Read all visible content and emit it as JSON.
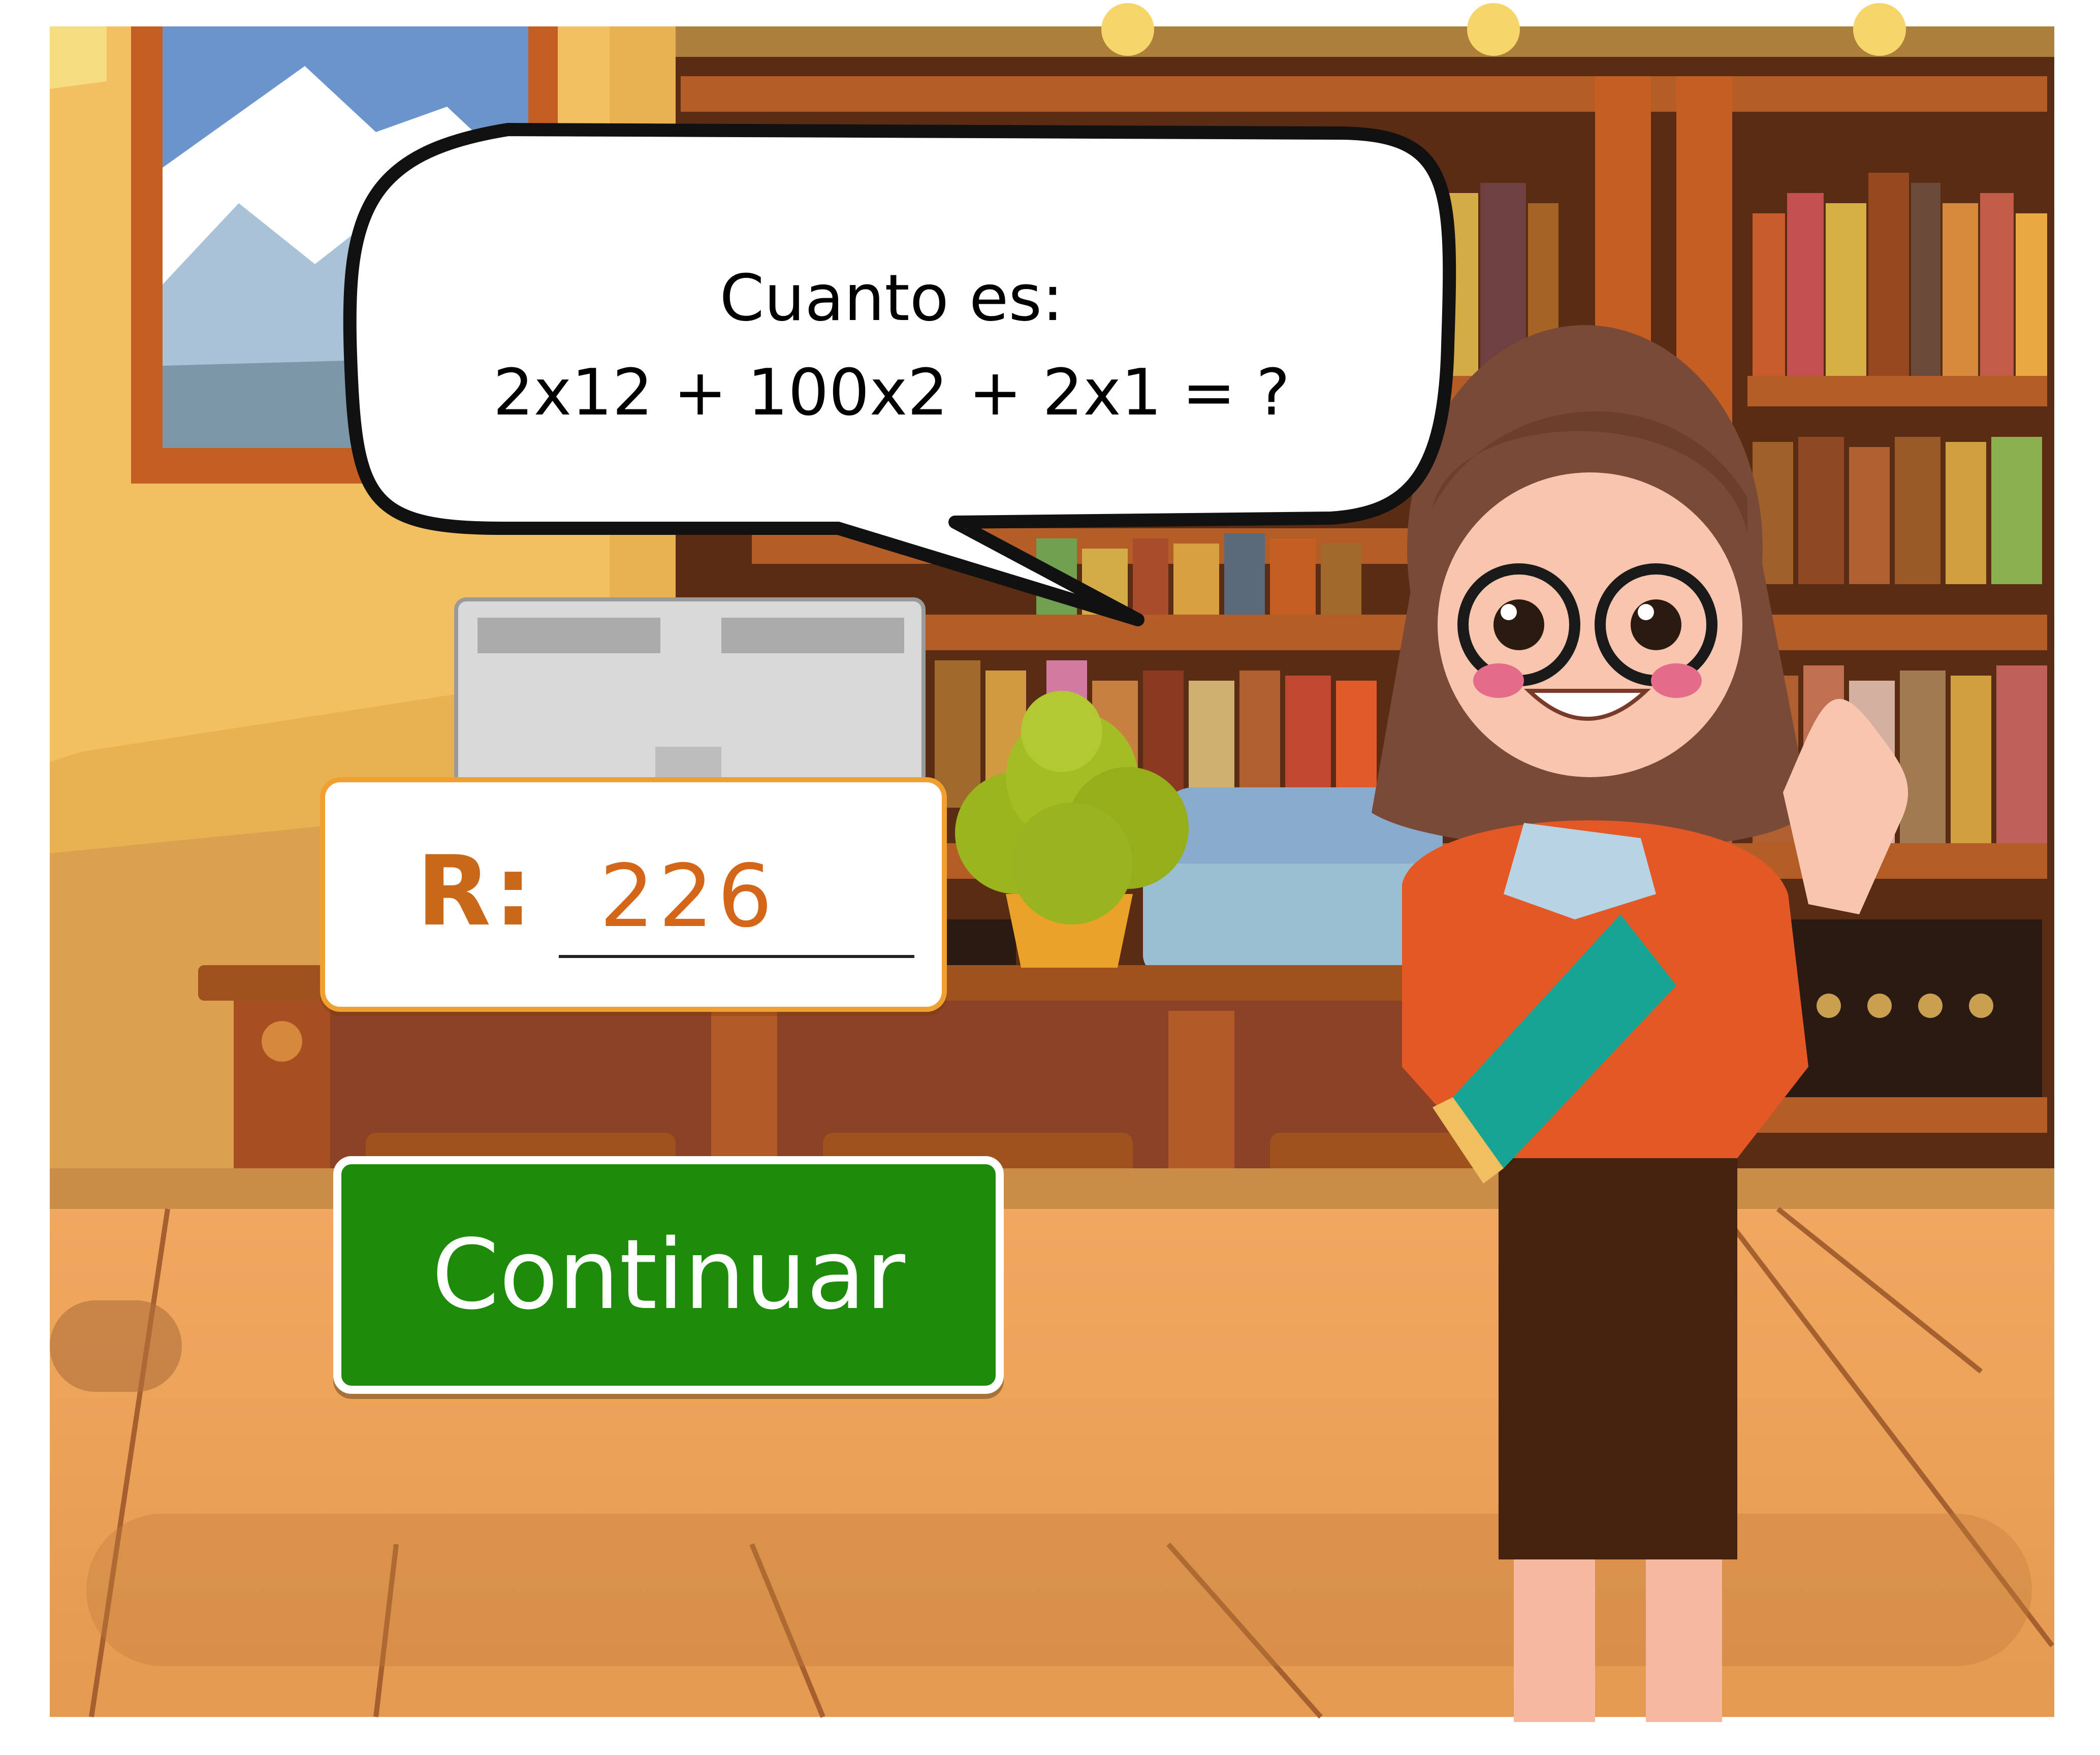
{
  "scene": {
    "name": "library-classroom",
    "icons": [
      "mountain-painting",
      "bookshelf",
      "computer-monitor",
      "potted-plant",
      "office-chair",
      "wooden-desk",
      "teacher-character",
      "book"
    ]
  },
  "speech_bubble": {
    "line1": "Cuanto es:",
    "line2": "2x12 + 100x2 + 2x1 = ?"
  },
  "answer": {
    "prefix": "R:",
    "value": "226"
  },
  "continue_button": {
    "label": "Continuar"
  },
  "colors": {
    "accent_orange": "#d4661a",
    "button_green": "#1e8c0a",
    "frame_border": "#f0a030"
  }
}
